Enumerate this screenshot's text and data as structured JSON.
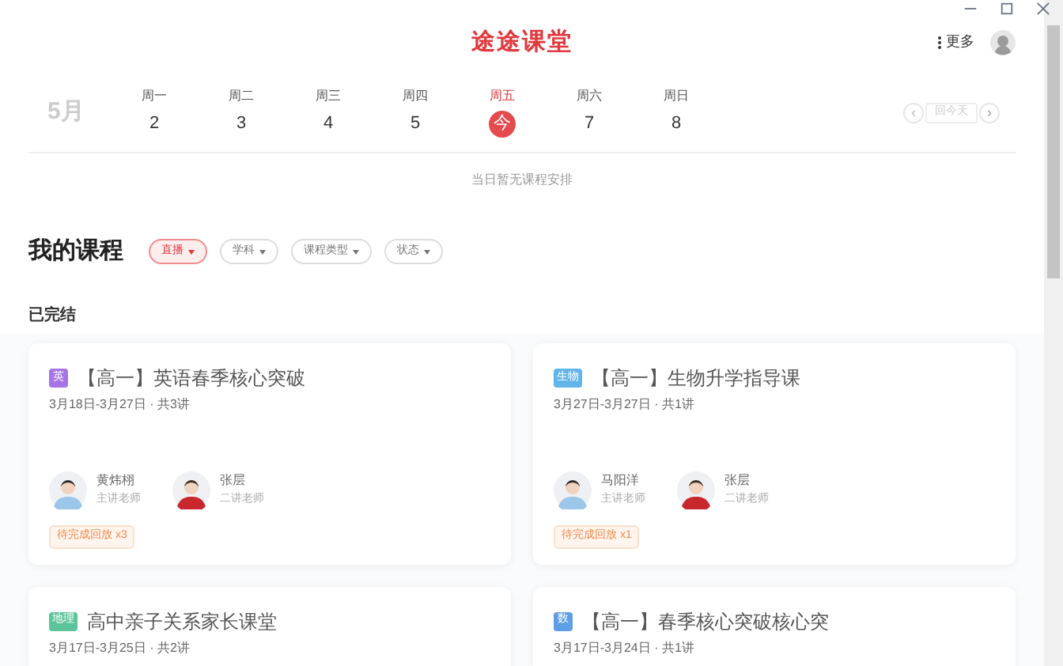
{
  "window": {
    "controls": [
      {
        "kind": "minimize"
      },
      {
        "kind": "maximize"
      },
      {
        "kind": "close"
      }
    ]
  },
  "header": {
    "logo": "途途课堂",
    "more": "更多"
  },
  "calendar": {
    "month": "5月",
    "nav": {
      "prev": "‹",
      "today": "回今天",
      "next": "›"
    },
    "days": [
      {
        "weekday": "周一",
        "date": "2",
        "selected": false
      },
      {
        "weekday": "周二",
        "date": "3",
        "selected": false
      },
      {
        "weekday": "周三",
        "date": "4",
        "selected": false
      },
      {
        "weekday": "周四",
        "date": "5",
        "selected": false
      },
      {
        "weekday": "周五",
        "date": "今",
        "selected": true
      },
      {
        "weekday": "周六",
        "date": "7",
        "selected": false
      },
      {
        "weekday": "周日",
        "date": "8",
        "selected": false
      }
    ],
    "empty_message": "当日暂无课程安排"
  },
  "courses": {
    "title": "我的课程",
    "filters": [
      {
        "label": "直播",
        "selected": true
      },
      {
        "label": "学科",
        "selected": false
      },
      {
        "label": "课程类型",
        "selected": false
      },
      {
        "label": "状态",
        "selected": false
      }
    ],
    "section": "已完结",
    "cards": [
      {
        "subject": "英",
        "color": "#a574e6",
        "title": "【高一】英语春季核心突破",
        "dates": "3月18日-3月27日 · 共3讲",
        "teachers": [
          {
            "name": "黄炜栩",
            "role": "主讲老师"
          },
          {
            "name": "张层",
            "role": "二讲老师"
          }
        ],
        "tag": "待完成回放 x3"
      },
      {
        "subject": "生物",
        "color": "#62b5ea",
        "title": "【高一】生物升学指导课",
        "dates": "3月27日-3月27日 · 共1讲",
        "teachers": [
          {
            "name": "马阳洋",
            "role": "主讲老师"
          },
          {
            "name": "张层",
            "role": "二讲老师"
          }
        ],
        "tag": "待完成回放 x1"
      },
      {
        "subject": "地理",
        "color": "#5cc49a",
        "title": "高中亲子关系家长课堂",
        "dates": "3月17日-3月25日 · 共2讲"
      },
      {
        "subject": "数",
        "color": "#5d9fe6",
        "title": "【高一】春季核心突破核心突",
        "dates": "3月17日-3月24日 · 共1讲"
      }
    ]
  }
}
